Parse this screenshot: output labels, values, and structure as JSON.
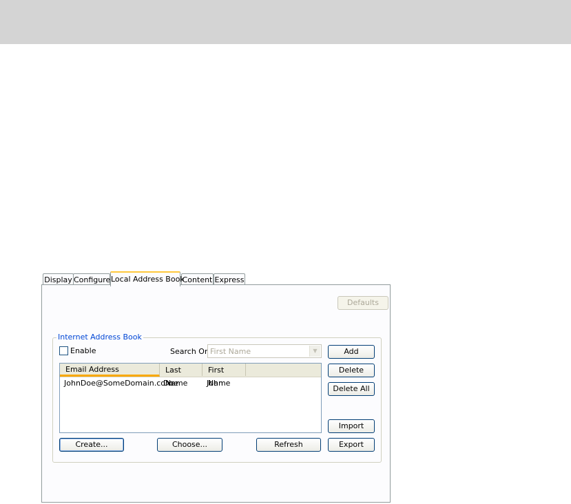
{
  "tabs": [
    {
      "label": "Display",
      "active": false
    },
    {
      "label": "Configure",
      "active": false
    },
    {
      "label": "Local Address Book",
      "active": true
    },
    {
      "label": "Content",
      "active": false
    },
    {
      "label": "Express",
      "active": false
    }
  ],
  "buttons": {
    "defaults": "Defaults",
    "add": "Add",
    "delete": "Delete",
    "delete_all": "Delete All",
    "import": "Import",
    "export": "Export",
    "create": "Create...",
    "choose": "Choose...",
    "refresh": "Refresh"
  },
  "group": {
    "title": "Internet Address Book",
    "enable_label": "Enable",
    "enable_checked": false,
    "search_on_label": "Search On:",
    "search_on_value": "First Name"
  },
  "table": {
    "columns": [
      "Email Address",
      "Last Name",
      "First Name"
    ],
    "rows": [
      {
        "email": "JohnDoe@SomeDomain.com",
        "last_name": "Doe",
        "first_name": "John"
      }
    ]
  },
  "colors": {
    "top_bar": "#d4d4d4",
    "active_tab_accent": "#ffc83c",
    "group_title": "#0046d5",
    "sort_indicator": "#f9a800"
  }
}
